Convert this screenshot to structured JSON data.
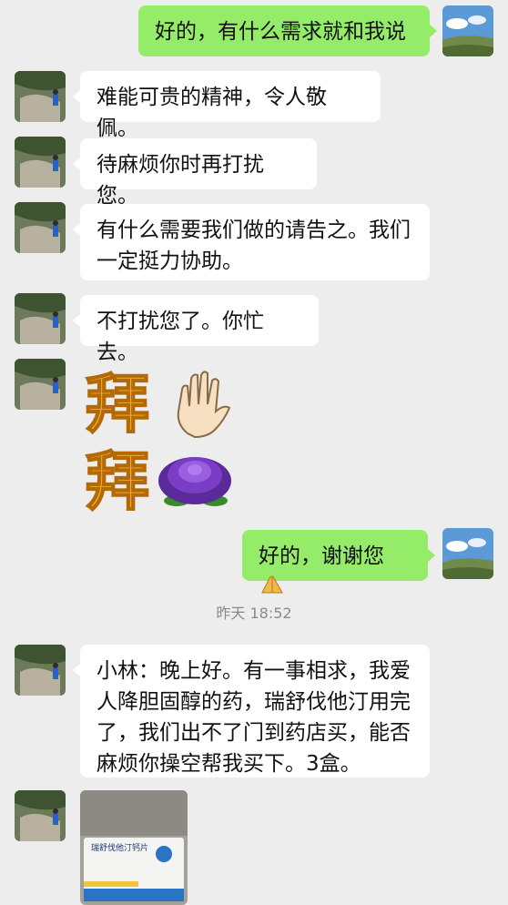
{
  "messages": [
    {
      "side": "out",
      "text": "好的，有什么需求就和我说"
    },
    {
      "side": "in",
      "text": "难能可贵的精神，令人敬佩。"
    },
    {
      "side": "in",
      "text": "待麻烦你时再打扰您。"
    },
    {
      "side": "in",
      "text": "有什么需要我们做的请告之。我们一定挺力协助。"
    },
    {
      "side": "in",
      "text": "不打扰您了。你忙去。"
    },
    {
      "side": "in",
      "sticker_text": "拜拜"
    },
    {
      "side": "out",
      "text": "好的，谢谢您"
    },
    {
      "side": "in",
      "text": "小林：晚上好。有一事相求，我爱人降胆固醇的药，瑞舒伐他汀用完了，我们出不了门到药店买，能否麻烦你操空帮我买下。3盒。"
    },
    {
      "side": "in",
      "image_label": "瑞舒伐他汀钙片"
    }
  ],
  "timestamp": "昨天 18:52",
  "colors": {
    "background": "#ededed",
    "outgoing_bubble": "#95ec69",
    "incoming_bubble": "#ffffff",
    "timestamp_text": "#8a8a8a"
  },
  "icons": [
    "user-avatar",
    "contact-avatar",
    "waving-hand-icon",
    "peony-flower-icon",
    "folded-hands-icon"
  ]
}
